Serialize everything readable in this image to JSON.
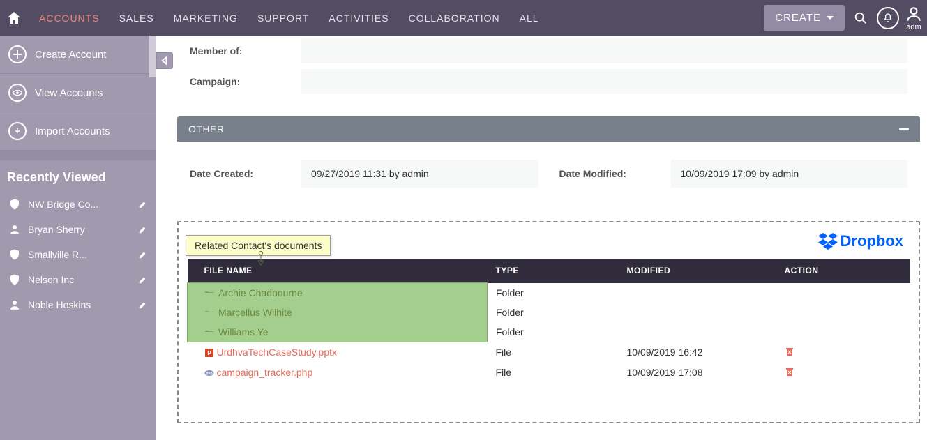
{
  "topnav": {
    "items": [
      "ACCOUNTS",
      "SALES",
      "MARKETING",
      "SUPPORT",
      "ACTIVITIES",
      "COLLABORATION",
      "ALL"
    ],
    "active_index": 0,
    "create_label": "CREATE",
    "user_label": "adm"
  },
  "sidebar": {
    "actions": [
      {
        "label": "Create Account",
        "icon": "plus"
      },
      {
        "label": "View Accounts",
        "icon": "eye"
      },
      {
        "label": "Import Accounts",
        "icon": "download"
      }
    ],
    "recent_heading": "Recently Viewed",
    "recent": [
      {
        "label": "NW Bridge Co...",
        "icon": "shield"
      },
      {
        "label": "Bryan Sherry",
        "icon": "person"
      },
      {
        "label": "Smallville R...",
        "icon": "shield"
      },
      {
        "label": "Nelson Inc",
        "icon": "shield"
      },
      {
        "label": "Noble Hoskins",
        "icon": "person"
      }
    ]
  },
  "fields": {
    "member_of_label": "Member of:",
    "campaign_label": "Campaign:"
  },
  "other_panel": {
    "title": "OTHER",
    "date_created_label": "Date Created:",
    "date_created_value": "09/27/2019 11:31 by admin",
    "date_modified_label": "Date Modified:",
    "date_modified_value": "10/09/2019 17:09 by admin"
  },
  "dropbox": {
    "tooltip": "Related Contact's documents",
    "logo_label": "Dropbox",
    "columns": {
      "name": "FILE NAME",
      "type": "TYPE",
      "modified": "MODIFIED",
      "action": "ACTION"
    },
    "rows": [
      {
        "kind": "folder",
        "name": "Archie Chadbourne",
        "type": "Folder",
        "modified": "",
        "deletable": false
      },
      {
        "kind": "folder",
        "name": "Marcellus Wilhite",
        "type": "Folder",
        "modified": "",
        "deletable": false
      },
      {
        "kind": "folder",
        "name": "Williams Ye",
        "type": "Folder",
        "modified": "",
        "deletable": false
      },
      {
        "kind": "file_pptx",
        "name": "UrdhvaTechCaseStudy.pptx",
        "type": "File",
        "modified": "10/09/2019 16:42",
        "deletable": true
      },
      {
        "kind": "file_php",
        "name": "campaign_tracker.php",
        "type": "File",
        "modified": "10/09/2019 17:08",
        "deletable": true
      }
    ]
  }
}
